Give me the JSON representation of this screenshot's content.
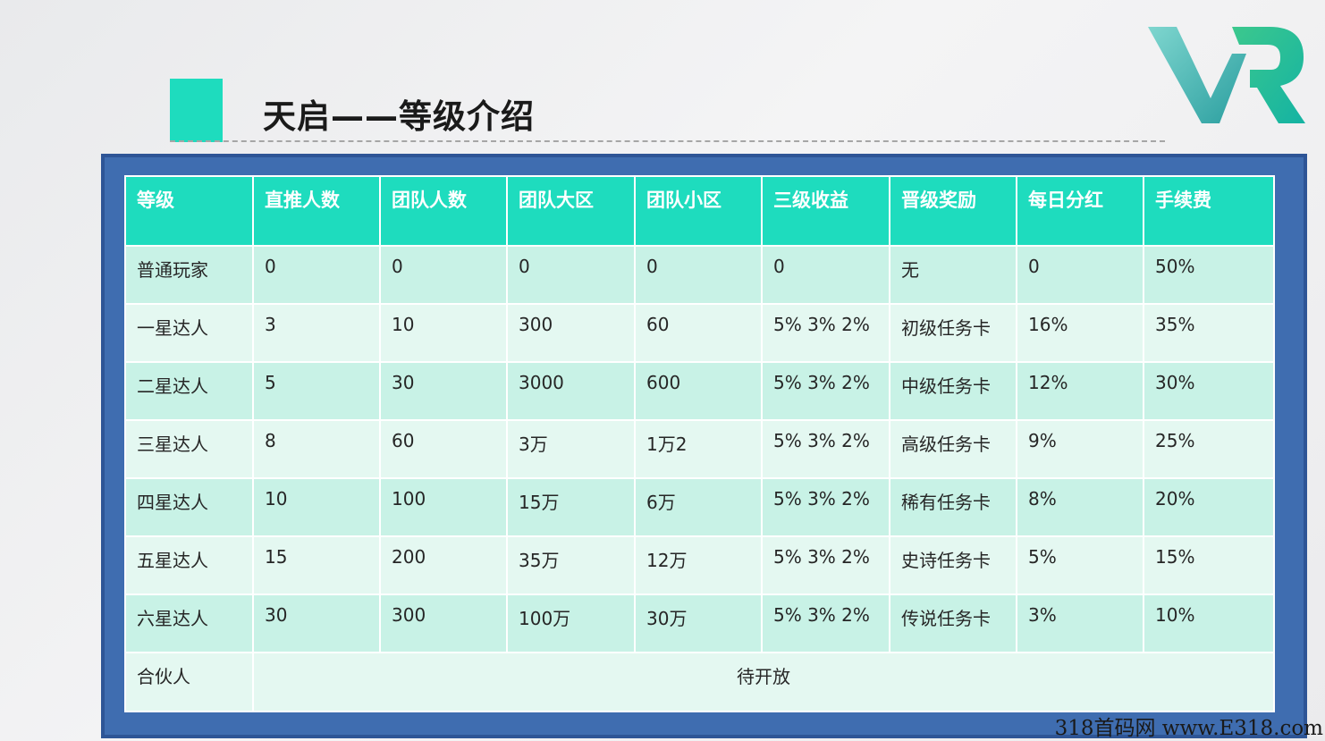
{
  "title": "天启——等级介绍",
  "logo_text": "VR",
  "colors": {
    "accent": "#1edcbe",
    "frame": "#3f6db0",
    "row_a": "#c8f2e6",
    "row_b": "#e4f8f1"
  },
  "table": {
    "headers": [
      "等级",
      "直推人数",
      "团队人数",
      "团队大区",
      "团队小区",
      "三级收益",
      "晋级奖励",
      "每日分红",
      "手续费"
    ],
    "rows": [
      [
        "普通玩家",
        "0",
        "0",
        "0",
        "0",
        "0",
        "无",
        "0",
        "50%"
      ],
      [
        "一星达人",
        "3",
        "10",
        "300",
        "60",
        "5% 3% 2%",
        "初级任务卡",
        "16%",
        "35%"
      ],
      [
        "二星达人",
        "5",
        "30",
        "3000",
        "600",
        "5% 3% 2%",
        "中级任务卡",
        "12%",
        "30%"
      ],
      [
        "三星达人",
        "8",
        "60",
        "3万",
        "1万2",
        "5% 3% 2%",
        "高级任务卡",
        "9%",
        "25%"
      ],
      [
        "四星达人",
        "10",
        "100",
        "15万",
        "6万",
        "5% 3% 2%",
        "稀有任务卡",
        "8%",
        "20%"
      ],
      [
        "五星达人",
        "15",
        "200",
        "35万",
        "12万",
        "5% 3% 2%",
        "史诗任务卡",
        "5%",
        "15%"
      ],
      [
        "六星达人",
        "30",
        "300",
        "100万",
        "30万",
        "5% 3% 2%",
        "传说任务卡",
        "3%",
        "10%"
      ]
    ],
    "partner": {
      "label": "合伙人",
      "note": "待开放"
    }
  },
  "watermark": "318首码网 www.E318.com"
}
